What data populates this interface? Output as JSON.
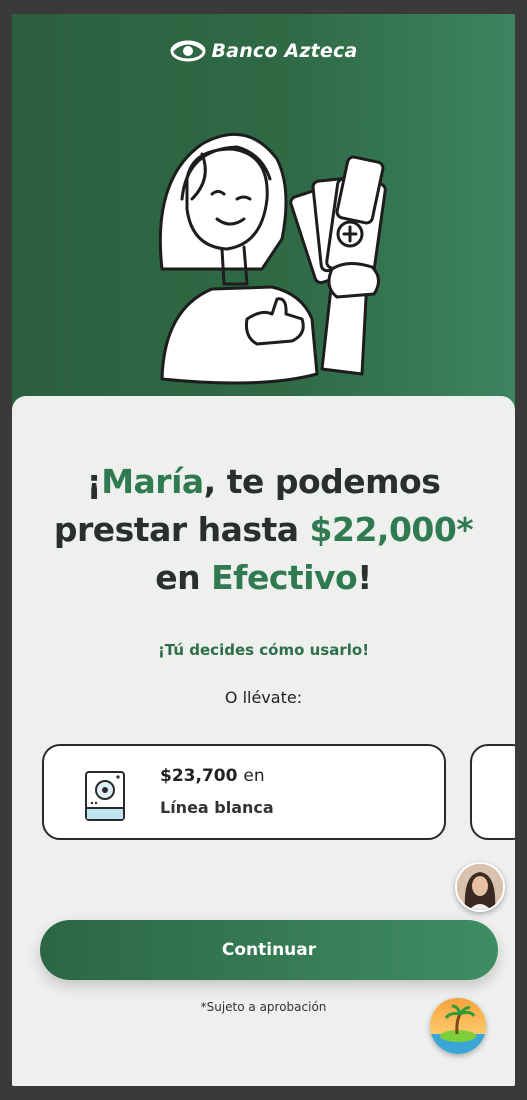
{
  "brand": {
    "name": "Banco Azteca",
    "logo_icon": "eye-logo-icon"
  },
  "hero": {
    "illustration": "woman-holding-cash-and-phone"
  },
  "headline": {
    "p1": "¡",
    "name": "María",
    "p2": ", te podemos prestar hasta ",
    "amount": "$22,000*",
    "p3": " en ",
    "product": "Efectivo",
    "p4": "!"
  },
  "tagline": "¡Tú decides cómo usarlo!",
  "alt_prompt": "O llévate:",
  "offers": [
    {
      "icon": "washing-machine-icon",
      "amount": "$23,700",
      "connector": "en",
      "category": "Línea blanca"
    }
  ],
  "cta": {
    "label": "Continuar"
  },
  "disclaimer": "*Sujeto a aprobación",
  "colors": {
    "brand_green": "#2f6a45",
    "accent_green": "#2f7a50",
    "background": "#eef0ee"
  }
}
